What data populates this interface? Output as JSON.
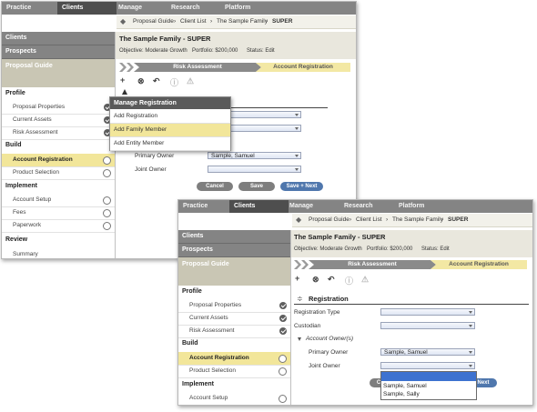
{
  "nav": {
    "items": [
      "Practice",
      "Clients",
      "Manage",
      "Research",
      "Platform"
    ]
  },
  "breadcrumb": {
    "items": [
      "Proposal Guide",
      "Client List",
      "The Sample Family",
      "SUPER"
    ]
  },
  "sidebar": {
    "clients": "Clients",
    "prospects": "Prospects",
    "proposal_guide": "Proposal Guide",
    "sections": {
      "profile": "Profile",
      "build": "Build",
      "implement": "Implement",
      "review": "Review"
    },
    "items": {
      "proposal_properties": "Proposal Properties",
      "current_assets": "Current Assets",
      "risk_assessment": "Risk Assessment",
      "account_registration": "Account Registration",
      "product_selection": "Product Selection",
      "account_setup": "Account Setup",
      "fees": "Fees",
      "paperwork": "Paperwork",
      "summary": "Summary"
    }
  },
  "header": {
    "title": "The Sample Family - SUPER",
    "objective": "Objective: Moderate Growth",
    "portfolio": "Portfolio: $200,000",
    "status": "Status: Edit"
  },
  "steps": {
    "step1": "Risk Assessment",
    "step2": "Account Registration"
  },
  "toolbar": {
    "add": "+",
    "remove": "⊗",
    "undo": "↶",
    "info": "ⓘ",
    "warn": "⚠"
  },
  "manage_menu": {
    "title": "Manage Registration",
    "items": [
      "Add Registration",
      "Add Family Member",
      "Add Entity Member"
    ]
  },
  "form": {
    "section": "Registration",
    "registration_type": "Registration Type",
    "custodian": "Custodian",
    "account_owners": "Account Owner(s)",
    "primary_owner": "Primary Owner",
    "joint_owner": "Joint Owner",
    "primary_value": "Sample, Samuel",
    "joint_options": [
      "Sample, Samuel",
      "Sample, Sally"
    ]
  },
  "buttons": {
    "cancel": "Cancel",
    "save": "Save",
    "save_next": "Save + Next",
    "next_fragment": "Next",
    "left_fragment": "C"
  }
}
